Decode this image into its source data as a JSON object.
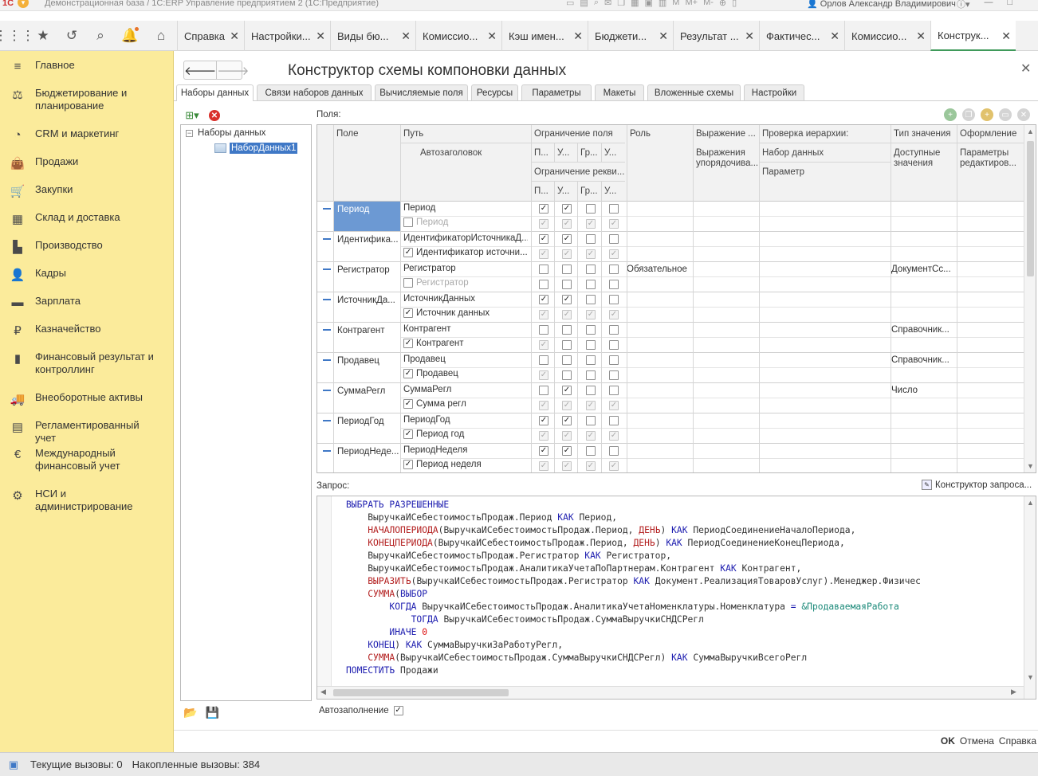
{
  "window": {
    "title": "Демонстрационная база / 1С:ERP Управление предприятием 2  (1С:Предприятие)",
    "user": "Орлов Александр Владимирович",
    "tool_labels": [
      "M",
      "M+",
      "M-"
    ]
  },
  "tabs": [
    {
      "label": "Справка"
    },
    {
      "label": "Настройки..."
    },
    {
      "label": "Виды   бю..."
    },
    {
      "label": "Комиссио..."
    },
    {
      "label": "Кэш имен..."
    },
    {
      "label": "Бюджети..."
    },
    {
      "label": "Результат ..."
    },
    {
      "label": "Фактичес..."
    },
    {
      "label": "Комиссио..."
    },
    {
      "label": "Конструк..."
    }
  ],
  "sidebar": {
    "items": [
      {
        "label": "Главное",
        "icon": "menu-icon"
      },
      {
        "label": "Бюджетирование и планирование",
        "icon": "budget-icon"
      },
      {
        "label": "CRM и маркетинг",
        "icon": "pie-chart-icon"
      },
      {
        "label": "Продажи",
        "icon": "bag-icon"
      },
      {
        "label": "Закупки",
        "icon": "cart-icon"
      },
      {
        "label": "Склад и доставка",
        "icon": "warehouse-icon"
      },
      {
        "label": "Производство",
        "icon": "factory-icon"
      },
      {
        "label": "Кадры",
        "icon": "person-icon"
      },
      {
        "label": "Зарплата",
        "icon": "wallet-icon"
      },
      {
        "label": "Казначейство",
        "icon": "ruble-icon"
      },
      {
        "label": "Финансовый результат и контроллинг",
        "icon": "bar-chart-icon"
      },
      {
        "label": "Внеоборотные активы",
        "icon": "truck-icon"
      },
      {
        "label": "Регламентированный учет",
        "icon": "calculator-icon"
      },
      {
        "label": "Международный финансовый учет",
        "icon": "euro-icon"
      },
      {
        "label": "НСИ и администрирование",
        "icon": "gear-icon"
      }
    ]
  },
  "form": {
    "title": "Конструктор схемы компоновки данных",
    "tabs": [
      "Наборы данных",
      "Связи наборов данных",
      "Вычисляемые поля",
      "Ресурсы",
      "Параметры",
      "Макеты",
      "Вложенные схемы",
      "Настройки"
    ],
    "tree": {
      "root": "Наборы данных",
      "child": "НаборДанных1"
    },
    "fields_label": "Поля:",
    "grid": {
      "headers": {
        "field": "Поле",
        "path": "Путь",
        "autotitle": "Автозаголовок",
        "restriction": "Ограничение поля",
        "r1": "П...",
        "r2": "У...",
        "r3": "Гр...",
        "r4": "У...",
        "req_restriction": "Ограничение рекви...",
        "q1": "П...",
        "q2": "У...",
        "q3": "Гр...",
        "q4": "У...",
        "role": "Роль",
        "expression": "Выражение ...",
        "order_expr": "Выражения упорядочива...",
        "hier_check": "Проверка иерархии:",
        "dataset": "Набор данных",
        "param": "Параметр",
        "value_type": "Тип значения",
        "avail_values": "Доступные значения",
        "design": "Оформление",
        "editor_params": "Параметры редактиров..."
      },
      "rows": [
        {
          "name": "Период",
          "path": "Период",
          "title": "Период",
          "title_checked": false,
          "role": "",
          "value_type": "",
          "checks": [
            [
              1,
              1,
              0,
              0
            ],
            [
              1,
              1,
              1,
              1
            ]
          ],
          "selected": true
        },
        {
          "name": "Идентифика...",
          "path": "ИдентификаторИсточникаД...",
          "title": "Идентификатор источни...",
          "title_checked": true,
          "role": "",
          "value_type": "",
          "checks": [
            [
              1,
              1,
              0,
              0
            ],
            [
              1,
              1,
              1,
              1
            ]
          ]
        },
        {
          "name": "Регистратор",
          "path": "Регистратор",
          "title": "Регистратор",
          "title_checked": false,
          "role": "Обязательное",
          "value_type": "ДокументСс...",
          "checks": [
            [
              0,
              0,
              0,
              0
            ],
            [
              0,
              0,
              0,
              0
            ]
          ]
        },
        {
          "name": "ИсточникДа...",
          "path": "ИсточникДанных",
          "title": "Источник данных",
          "title_checked": true,
          "role": "",
          "value_type": "",
          "checks": [
            [
              1,
              1,
              0,
              0
            ],
            [
              1,
              1,
              1,
              1
            ]
          ]
        },
        {
          "name": "Контрагент",
          "path": "Контрагент",
          "title": "Контрагент",
          "title_checked": true,
          "role": "",
          "value_type": "Справочник...",
          "checks": [
            [
              0,
              0,
              0,
              0
            ],
            [
              1,
              0,
              0,
              0
            ]
          ]
        },
        {
          "name": "Продавец",
          "path": "Продавец",
          "title": "Продавец",
          "title_checked": true,
          "role": "",
          "value_type": "Справочник...",
          "checks": [
            [
              0,
              0,
              0,
              0
            ],
            [
              1,
              0,
              0,
              0
            ]
          ]
        },
        {
          "name": "СуммаРегл",
          "path": "СуммаРегл",
          "title": "Сумма регл",
          "title_checked": true,
          "role": "",
          "value_type": "Число",
          "checks": [
            [
              0,
              1,
              0,
              0
            ],
            [
              1,
              1,
              1,
              1
            ]
          ]
        },
        {
          "name": "ПериодГод",
          "path": "ПериодГод",
          "title": "Период год",
          "title_checked": true,
          "role": "",
          "value_type": "",
          "checks": [
            [
              1,
              1,
              0,
              0
            ],
            [
              1,
              1,
              1,
              1
            ]
          ]
        },
        {
          "name": "ПериодНеде...",
          "path": "ПериодНеделя",
          "title": "Период неделя",
          "title_checked": true,
          "role": "",
          "value_type": "",
          "checks": [
            [
              1,
              1,
              0,
              0
            ],
            [
              1,
              1,
              1,
              1
            ]
          ]
        }
      ]
    },
    "query_label": "Запрос:",
    "query_builder": "Конструктор запроса...",
    "query_lines": [
      [
        [
          "kw",
          "ВЫБРАТЬ РАЗРЕШЕННЫЕ"
        ]
      ],
      [
        [
          "t",
          "    ВыручкаИСебестоимостьПродаж.Период "
        ],
        [
          "kw",
          "КАК"
        ],
        [
          "t",
          " Период,"
        ]
      ],
      [
        [
          "t",
          "    "
        ],
        [
          "fn",
          "НАЧАЛОПЕРИОДА"
        ],
        [
          "t",
          "(ВыручкаИСебестоимостьПродаж.Период, "
        ],
        [
          "fn",
          "ДЕНЬ"
        ],
        [
          "t",
          ") "
        ],
        [
          "kw",
          "КАК"
        ],
        [
          "t",
          " ПериодСоединениеНачалоПериода,"
        ]
      ],
      [
        [
          "t",
          "    "
        ],
        [
          "fn",
          "КОНЕЦПЕРИОДА"
        ],
        [
          "t",
          "(ВыручкаИСебестоимостьПродаж.Период, "
        ],
        [
          "fn",
          "ДЕНЬ"
        ],
        [
          "t",
          ") "
        ],
        [
          "kw",
          "КАК"
        ],
        [
          "t",
          " ПериодСоединениеКонецПериода,"
        ]
      ],
      [
        [
          "t",
          "    ВыручкаИСебестоимостьПродаж.Регистратор "
        ],
        [
          "kw",
          "КАК"
        ],
        [
          "t",
          " Регистратор,"
        ]
      ],
      [
        [
          "t",
          "    ВыручкаИСебестоимостьПродаж.АналитикаУчетаПоПартнерам.Контрагент "
        ],
        [
          "kw",
          "КАК"
        ],
        [
          "t",
          " Контрагент,"
        ]
      ],
      [
        [
          "t",
          "    "
        ],
        [
          "fn",
          "ВЫРАЗИТЬ"
        ],
        [
          "t",
          "(ВыручкаИСебестоимостьПродаж.Регистратор "
        ],
        [
          "kw",
          "КАК"
        ],
        [
          "t",
          " Документ.РеализацияТоваровУслуг).Менеджер.Физичес"
        ]
      ],
      [
        [
          "t",
          "    "
        ],
        [
          "fn",
          "СУММА"
        ],
        [
          "t",
          "("
        ],
        [
          "kw",
          "ВЫБОР"
        ]
      ],
      [
        [
          "t",
          "        "
        ],
        [
          "kw",
          "КОГДА"
        ],
        [
          "t",
          " ВыручкаИСебестоимостьПродаж.АналитикаУчетаНоменклатуры.Номенклатура "
        ],
        [
          "kw",
          "="
        ],
        [
          "t",
          " "
        ],
        [
          "par",
          "&ПродаваемаяРабота"
        ]
      ],
      [
        [
          "t",
          "            "
        ],
        [
          "kw",
          "ТОГДА"
        ],
        [
          "t",
          " ВыручкаИСебестоимостьПродаж.СуммаВыручкиСНДСРегл"
        ]
      ],
      [
        [
          "t",
          "        "
        ],
        [
          "kw",
          "ИНАЧЕ"
        ],
        [
          "t",
          " "
        ],
        [
          "num",
          "0"
        ]
      ],
      [
        [
          "t",
          "    "
        ],
        [
          "kw",
          "КОНЕЦ"
        ],
        [
          "t",
          ") "
        ],
        [
          "kw",
          "КАК"
        ],
        [
          "t",
          " СуммаВыручкиЗаРаботуРегл,"
        ]
      ],
      [
        [
          "t",
          "    "
        ],
        [
          "fn",
          "СУММА"
        ],
        [
          "t",
          "(ВыручкаИСебестоимостьПродаж.СуммаВыручкиСНДСРегл) "
        ],
        [
          "kw",
          "КАК"
        ],
        [
          "t",
          " СуммаВыручкиВсегоРегл"
        ]
      ],
      [
        [
          "kw",
          "ПОМЕСТИТЬ"
        ],
        [
          "t",
          " Продажи"
        ]
      ]
    ],
    "autofill_label": "Автозаполнение",
    "autofill_checked": true,
    "footer": {
      "ok": "OK",
      "cancel": "Отмена",
      "help": "Справка"
    }
  },
  "status": {
    "current_calls": "Текущие вызовы: 0",
    "accumulated_calls": "Накопленные вызовы: 384"
  }
}
